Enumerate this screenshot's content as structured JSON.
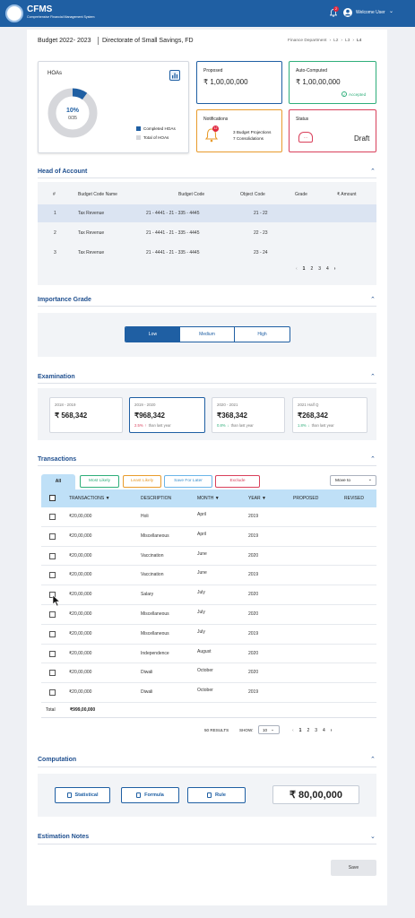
{
  "header": {
    "app_name": "CFMS",
    "app_subtitle": "Comprehensive Financial Management System",
    "notif_count": "2",
    "welcome": "Welcome User"
  },
  "page": {
    "title": "Budget 2022- 2023",
    "dept": "Directorate of Small Savings, FD",
    "breadcrumb": [
      "Finance Department",
      "L2",
      "L3",
      "L4"
    ]
  },
  "hoas": {
    "title": "HOAs",
    "percent": "10%",
    "ratio": "0/35",
    "legend": [
      "Completed HOAs",
      "Total of HOAs"
    ],
    "progress": 0.1
  },
  "proposed": {
    "label": "Proposed",
    "value": "₹ 1,00,00,000"
  },
  "auto": {
    "label": "Auto-Computed",
    "value": "₹ 1,00,00,000",
    "status": "Accepted"
  },
  "notifications": {
    "label": "Notifications",
    "count": "12",
    "line1": "3 Budget Projections",
    "line2": "7 Consolidations"
  },
  "status": {
    "label": "Status",
    "value": "Draft"
  },
  "hoa_table": {
    "title": "Head of Account",
    "columns": [
      "#",
      "Budget Code Name",
      "Budget Code",
      "Object Code",
      "Grade",
      "₹ Amount"
    ],
    "rows": [
      [
        "1",
        "Tax Revenue",
        "21 - 4441 - 21 - 335 - 4445",
        "21 - 22",
        "",
        ""
      ],
      [
        "2",
        "Tax Revenue",
        "21 - 4441 - 21 - 335 - 4445",
        "22 - 23",
        "",
        ""
      ],
      [
        "3",
        "Tax Revenue",
        "21 - 4441 - 21 - 335 - 4445",
        "23 - 24",
        "",
        ""
      ]
    ],
    "pages": [
      "1",
      "2",
      "3",
      "4"
    ]
  },
  "importance": {
    "title": "Importance Grade",
    "options": [
      "Low",
      "Medium",
      "High"
    ]
  },
  "examination": {
    "title": "Examination",
    "cards": [
      {
        "year": "2018 - 2019",
        "value": "₹ 568,342",
        "pct": "",
        "note": ""
      },
      {
        "year": "2019 - 2020",
        "value": "₹968,342",
        "pct": "2.5%",
        "note": "than last year"
      },
      {
        "year": "2020 - 2021",
        "value": "₹368,342",
        "pct": "0.8%",
        "note": "than last year"
      },
      {
        "year": "2021 Half Q",
        "value": "₹268,342",
        "pct": "1.8%",
        "note": "than last year"
      }
    ]
  },
  "transactions": {
    "title": "Transactions",
    "tabs": [
      "All",
      "Most Likely",
      "Least Likely",
      "Save For Later",
      "Exclude"
    ],
    "move_to": "Move to",
    "columns": [
      "TRANSACTIONS",
      "DESCRIPTION",
      "MONTH",
      "YEAR",
      "PROPOSED",
      "REVISED"
    ],
    "rows": [
      [
        "₹20,00,000",
        "Holi",
        "April",
        "2019"
      ],
      [
        "₹20,00,000",
        "Miscellaneous",
        "April",
        "2019"
      ],
      [
        "₹20,00,000",
        "Vaccination",
        "June",
        "2020"
      ],
      [
        "₹20,00,000",
        "Vaccination",
        "June",
        "2019"
      ],
      [
        "₹20,00,000",
        "Salary",
        "July",
        "2020"
      ],
      [
        "₹20,00,000",
        "Miscellaneous",
        "July",
        "2020"
      ],
      [
        "₹20,00,000",
        "Miscellaneous",
        "July",
        "2019"
      ],
      [
        "₹20,00,000",
        "Independence",
        "August",
        "2020"
      ],
      [
        "₹20,00,000",
        "Diwali",
        "October",
        "2020"
      ],
      [
        "₹20,00,000",
        "Diwali",
        "October",
        "2019"
      ]
    ],
    "total_label": "Total",
    "total_value": "₹999,00,000",
    "results": "50 RESULTS",
    "show_label": "SHOW:",
    "show_value": "10",
    "pages": [
      "1",
      "2",
      "3",
      "4"
    ]
  },
  "computation": {
    "title": "Computation",
    "buttons": [
      "Statistical",
      "Formula",
      "Rule"
    ],
    "value": "₹ 80,00,000"
  },
  "notes": {
    "title": "Estimation Notes"
  },
  "save": "Save",
  "colors": {
    "primary": "#1f5fa3",
    "accent_green": "#2eae7a",
    "accent_orange": "#e89b2c",
    "accent_red": "#d9405b"
  }
}
